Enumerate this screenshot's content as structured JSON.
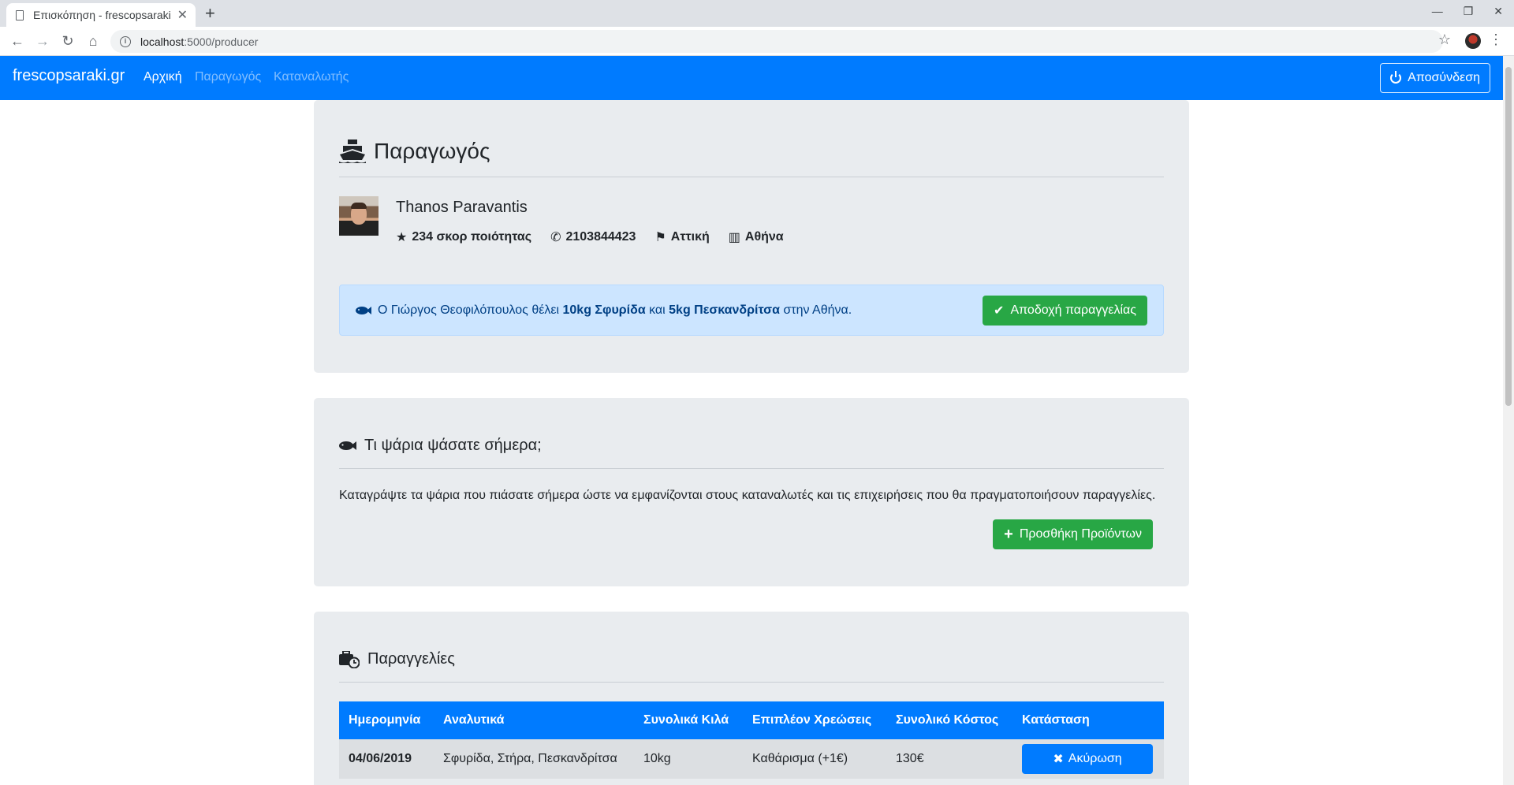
{
  "browser": {
    "tab_title": "Επισκόπηση - frescopsaraki.gr",
    "url_host": "localhost",
    "url_path": ":5000/producer"
  },
  "navbar": {
    "brand": "frescopsaraki.gr",
    "links": [
      "Αρχική",
      "Παραγωγός",
      "Καταναλωτής"
    ],
    "logout_label": "Αποσύνδεση",
    "color": "#007bff"
  },
  "producer": {
    "heading": "Παραγωγός",
    "name": "Thanos Paravantis",
    "score": "234 σκορ ποιότητας",
    "phone": "2103844423",
    "region": "Αττική",
    "city": "Αθήνα"
  },
  "order_alert": {
    "text_1": "Ο Γιώργος Θεοφιλόπουλος θέλει ",
    "item_1": "10kg Σφυρίδα",
    "text_2": " και ",
    "item_2": "5kg Πεσκανδρίτσα",
    "text_3": " στην Αθήνα.",
    "accept_label": "Αποδοχή παραγγελίας"
  },
  "catch": {
    "heading": "Τι ψάρια ψάσατε σήμερα;",
    "description": "Καταγράψτε τα ψάρια που πιάσατε σήμερα ώστε να εμφανίζονται στους καταναλωτές και τις επιχειρήσεις που θα πραγματοποιήσουν παραγγελίες.",
    "add_label": "Προσθήκη Προϊόντων"
  },
  "orders": {
    "heading": "Παραγγελίες",
    "columns": [
      "Ημερομηνία",
      "Αναλυτικά",
      "Συνολικά Κιλά",
      "Επιπλέον Χρεώσεις",
      "Συνολικό Κόστος",
      "Κατάσταση"
    ],
    "rows": [
      {
        "date": "04/06/2019",
        "details": "Σφυρίδα, Στήρα, Πεσκανδρίτσα",
        "kilos": "10kg",
        "extras": "Καθάρισμα (+1€)",
        "cost": "130€",
        "action": "Ακύρωση"
      }
    ]
  }
}
